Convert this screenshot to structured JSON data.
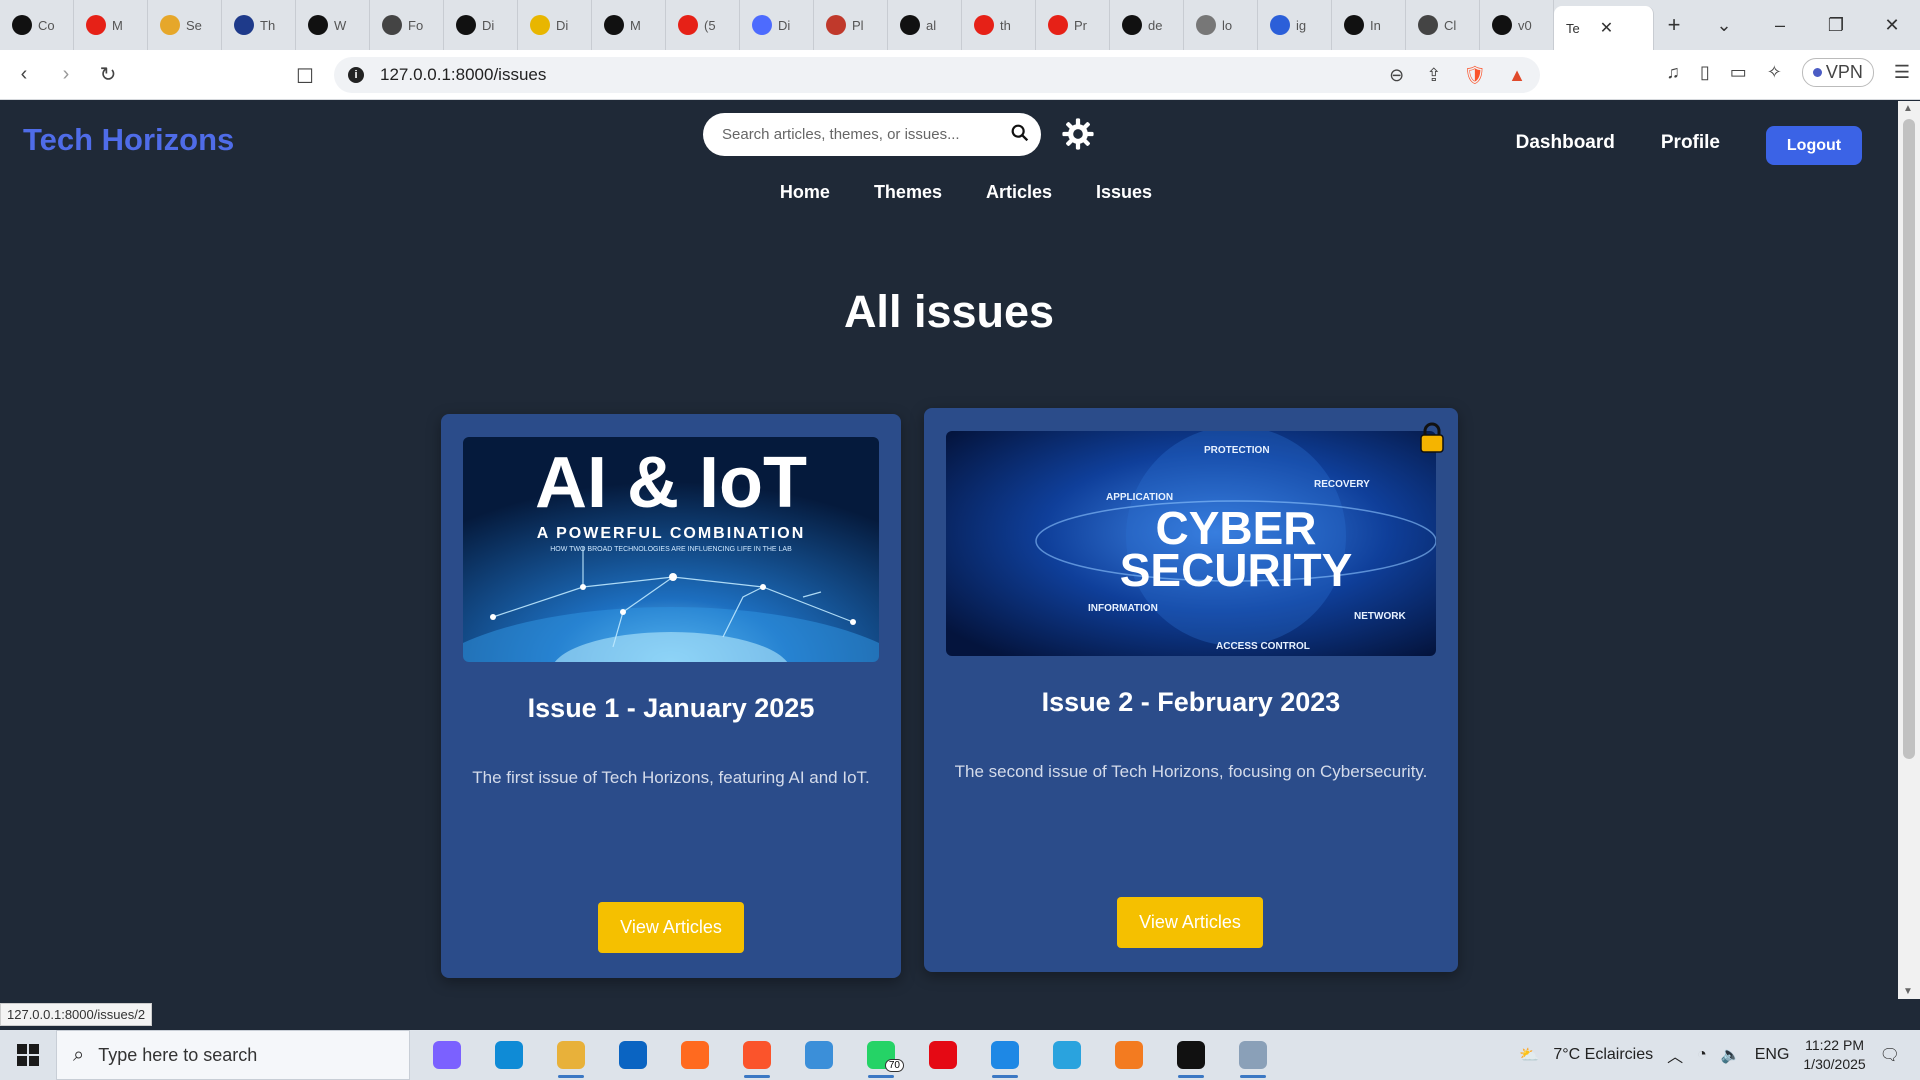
{
  "browser": {
    "tabs": [
      {
        "label": "Co",
        "icon": "github-icon",
        "color": "#111111"
      },
      {
        "label": "M",
        "icon": "youtube-icon",
        "color": "#e62117"
      },
      {
        "label": "Se",
        "icon": "star-icon",
        "color": "#e6a72a"
      },
      {
        "label": "Th",
        "icon": "power-icon",
        "color": "#1e3a8a"
      },
      {
        "label": "W",
        "icon": "m-logo-icon",
        "color": "#111111"
      },
      {
        "label": "Fo",
        "icon": "openai-icon",
        "color": "#444444"
      },
      {
        "label": "Di",
        "icon": "github-icon",
        "color": "#111111"
      },
      {
        "label": "Di",
        "icon": "slides-icon",
        "color": "#e8b600"
      },
      {
        "label": "M",
        "icon": "github-icon",
        "color": "#111111"
      },
      {
        "label": "(5",
        "icon": "youtube-icon",
        "color": "#e62117"
      },
      {
        "label": "Di",
        "icon": "deepseek-icon",
        "color": "#4d6bfe"
      },
      {
        "label": "Pl",
        "icon": "app-icon",
        "color": "#c0392b"
      },
      {
        "label": "al",
        "icon": "github-icon",
        "color": "#111111"
      },
      {
        "label": "th",
        "icon": "youtube-icon",
        "color": "#e62117"
      },
      {
        "label": "Pr",
        "icon": "youtube-icon",
        "color": "#e62117"
      },
      {
        "label": "de",
        "icon": "github-icon",
        "color": "#111111"
      },
      {
        "label": "lo",
        "icon": "mountain-icon",
        "color": "#777777"
      },
      {
        "label": "ig",
        "icon": "w-logo-icon",
        "color": "#2b5fd9"
      },
      {
        "label": "In",
        "icon": "threads-icon",
        "color": "#111111"
      },
      {
        "label": "Cl",
        "icon": "openai-icon",
        "color": "#444444"
      },
      {
        "label": "v0",
        "icon": "v0-icon",
        "color": "#111111"
      }
    ],
    "active_tab": "Te",
    "url": "127.0.0.1:8000/issues",
    "status_url": "127.0.0.1:8000/issues/2",
    "vpn_label": "VPN",
    "notification_count": "1"
  },
  "site": {
    "brand": "Tech Horizons",
    "search_placeholder": "Search articles, themes, or issues...",
    "top_links": {
      "dashboard": "Dashboard",
      "profile": "Profile",
      "logout": "Logout"
    },
    "nav": {
      "home": "Home",
      "themes": "Themes",
      "articles": "Articles",
      "issues": "Issues"
    },
    "heading": "All issues",
    "colors": {
      "brand": "#4f6ce8",
      "button": "#f5c000",
      "card": "#2b4c8a",
      "background": "#1f2937",
      "logout": "#3b63e6"
    }
  },
  "issues": [
    {
      "title": "Issue 1 - January 2025",
      "description": "The first issue of Tech Horizons, featuring AI and IoT.",
      "button": "View Articles",
      "locked": false,
      "image": {
        "headline": "AI & IoT",
        "subtitle": "A POWERFUL COMBINATION",
        "caption": "HOW TWO BROAD TECHNOLOGIES ARE INFLUENCING LIFE IN THE LAB"
      }
    },
    {
      "title": "Issue 2 - February 2023",
      "description": "The second issue of Tech Horizons, focusing on Cybersecurity.",
      "button": "View Articles",
      "locked": true,
      "image": {
        "line1": "CYBER",
        "line2": "SECURITY",
        "labels": {
          "protection": "PROTECTION",
          "application": "APPLICATION",
          "recovery": "RECOVERY",
          "information": "INFORMATION",
          "network": "NETWORK",
          "access": "ACCESS CONTROL"
        }
      }
    }
  ],
  "taskbar": {
    "search_placeholder": "Type here to search",
    "apps": [
      {
        "icon": "copilot-icon",
        "color": "#7b61ff",
        "running": false
      },
      {
        "icon": "edge-icon",
        "color": "#0f8bd6",
        "running": false
      },
      {
        "icon": "file-explorer-icon",
        "color": "#e8b13a",
        "running": true
      },
      {
        "icon": "outlook-icon",
        "color": "#0a64c2",
        "running": false
      },
      {
        "icon": "firefox-icon",
        "color": "#ff6a1f",
        "running": false
      },
      {
        "icon": "brave-icon",
        "color": "#fb542b",
        "running": true
      },
      {
        "icon": "qbittorrent-icon",
        "color": "#3b8fd9",
        "running": false
      },
      {
        "icon": "whatsapp-icon",
        "color": "#25d366",
        "running": true
      },
      {
        "icon": "netflix-icon",
        "color": "#e50914",
        "running": false
      },
      {
        "icon": "vscode-icon",
        "color": "#1e88e5",
        "running": true
      },
      {
        "icon": "telegram-icon",
        "color": "#2aa3de",
        "running": false
      },
      {
        "icon": "xampp-icon",
        "color": "#f37b20",
        "running": false
      },
      {
        "icon": "terminal-icon",
        "color": "#111111",
        "running": true
      },
      {
        "icon": "photos-icon",
        "color": "#8aa0b8",
        "running": true
      }
    ],
    "whatsapp_badge": "70",
    "weather": "7°C  Eclaircies",
    "language": "ENG",
    "time": "11:22 PM",
    "date": "1/30/2025"
  }
}
